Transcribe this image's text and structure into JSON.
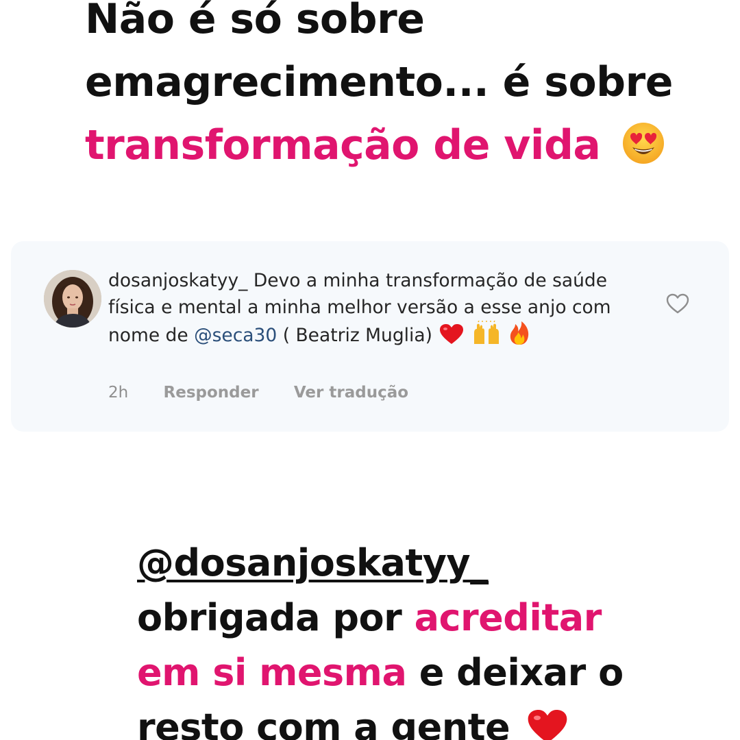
{
  "headline": {
    "line1": "Não é só sobre",
    "line2": "emagrecimento... é sobre",
    "line3_highlight": "transformação de vida",
    "emoji": "heart-eyes-emoji"
  },
  "comment": {
    "username": "dosanjoskatyy_",
    "text_before_mention": "Devo a minha transformação de saúde física e mental a minha melhor versão a esse anjo com nome de",
    "mention": "@seca30",
    "text_after_mention": "( Beatriz Muglia)",
    "emojis": [
      "red-heart-emoji",
      "raising-hands-emoji",
      "fire-emoji"
    ],
    "time": "2h",
    "reply_label": "Responder",
    "translate_label": "Ver tradução",
    "like_icon": "heart-outline-icon"
  },
  "thanks": {
    "mention": "@dosanjoskatyy_",
    "line2_plain": "obrigada por",
    "line2_highlight": "acreditar",
    "line3_highlight": "em si mesma",
    "line3_plain": "e deixar o",
    "line4_plain": "resto com a gente",
    "emoji": "red-heart-emoji"
  },
  "colors": {
    "accent_pink": "#e0156f",
    "text_dark": "#111111",
    "card_bg": "#f6f9fc",
    "meta_gray": "#8e8e8e",
    "mention_blue": "#2b4f7a"
  }
}
